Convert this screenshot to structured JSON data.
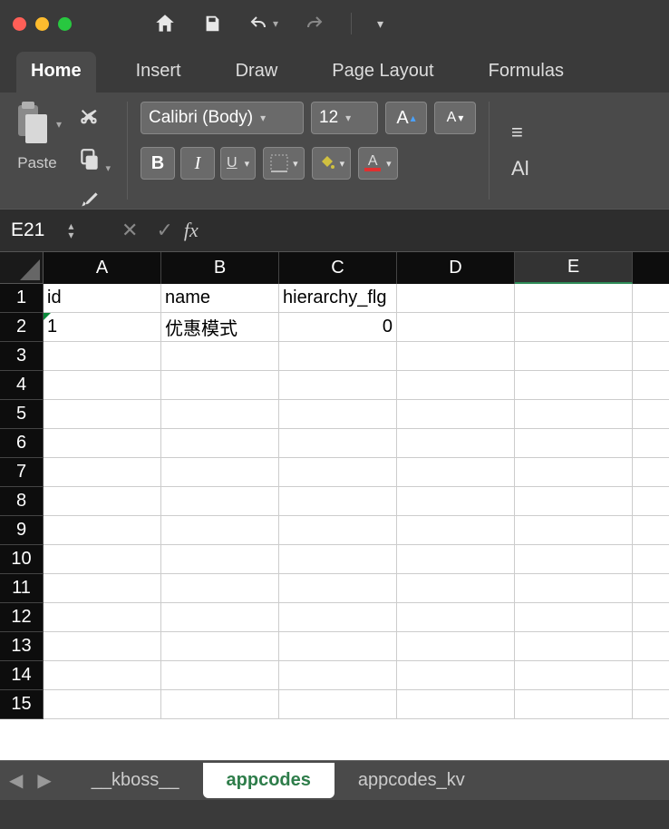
{
  "qat": {
    "undo": "↶",
    "redo": "↷"
  },
  "ribbon_tabs": [
    "Home",
    "Insert",
    "Draw",
    "Page Layout",
    "Formulas"
  ],
  "ribbon_tabs_active_index": 0,
  "clipboard": {
    "paste_label": "Paste"
  },
  "font": {
    "name": "Calibri (Body)",
    "size": "12",
    "bold": "B",
    "italic": "I",
    "underline": "U",
    "increase": "A▴",
    "decrease": "A▾"
  },
  "align_label_fragment": "Al",
  "namebox": "E21",
  "fx_label": "fx",
  "formula_value": "",
  "columns": [
    "A",
    "B",
    "C",
    "D",
    "E"
  ],
  "rows_count": 15,
  "selected_column": "E",
  "cell_data": {
    "headers": {
      "A": "id",
      "B": "name",
      "C": "hierarchy_flg"
    },
    "row2": {
      "A": "1",
      "B": "优惠模式",
      "C": "0"
    }
  },
  "sheets": [
    "__kboss__",
    "appcodes",
    "appcodes_kv"
  ],
  "active_sheet_index": 1
}
